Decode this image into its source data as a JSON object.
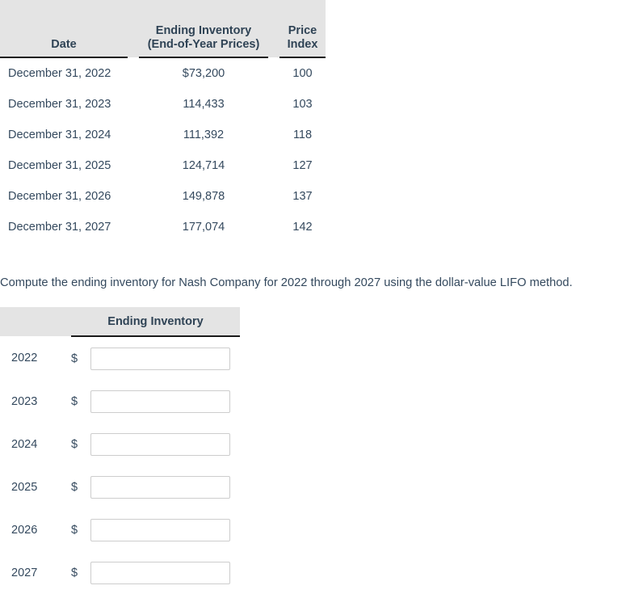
{
  "data_table": {
    "headers": {
      "date": "Date",
      "ending_inventory_line1": "Ending Inventory",
      "ending_inventory_line2": "(End-of-Year Prices)",
      "price_index_line1": "Price",
      "price_index_line2": "Index"
    },
    "rows": [
      {
        "date": "December 31, 2022",
        "ending_inventory": "$73,200",
        "price_index": "100"
      },
      {
        "date": "December 31, 2023",
        "ending_inventory": "114,433",
        "price_index": "103"
      },
      {
        "date": "December 31, 2024",
        "ending_inventory": "111,392",
        "price_index": "118"
      },
      {
        "date": "December 31, 2025",
        "ending_inventory": "124,714",
        "price_index": "127"
      },
      {
        "date": "December 31, 2026",
        "ending_inventory": "149,878",
        "price_index": "137"
      },
      {
        "date": "December 31, 2027",
        "ending_inventory": "177,074",
        "price_index": "142"
      }
    ]
  },
  "prompt": {
    "text": "Compute the ending inventory for Nash Company for 2022 through 2027 using the dollar-value LIFO method."
  },
  "answer_table": {
    "headers": {
      "blank": "",
      "ending_inventory": "Ending Inventory"
    },
    "currency_symbol": "$",
    "input_placeholder": "",
    "rows": [
      {
        "year": "2022",
        "value": ""
      },
      {
        "year": "2023",
        "value": ""
      },
      {
        "year": "2024",
        "value": ""
      },
      {
        "year": "2025",
        "value": ""
      },
      {
        "year": "2026",
        "value": ""
      },
      {
        "year": "2027",
        "value": ""
      }
    ]
  },
  "colors": {
    "header_background": "#e4e4e4",
    "text": "#34495e",
    "rule": "#1a1a1a",
    "input_border": "#cdcdcd",
    "page_background": "#ffffff"
  }
}
